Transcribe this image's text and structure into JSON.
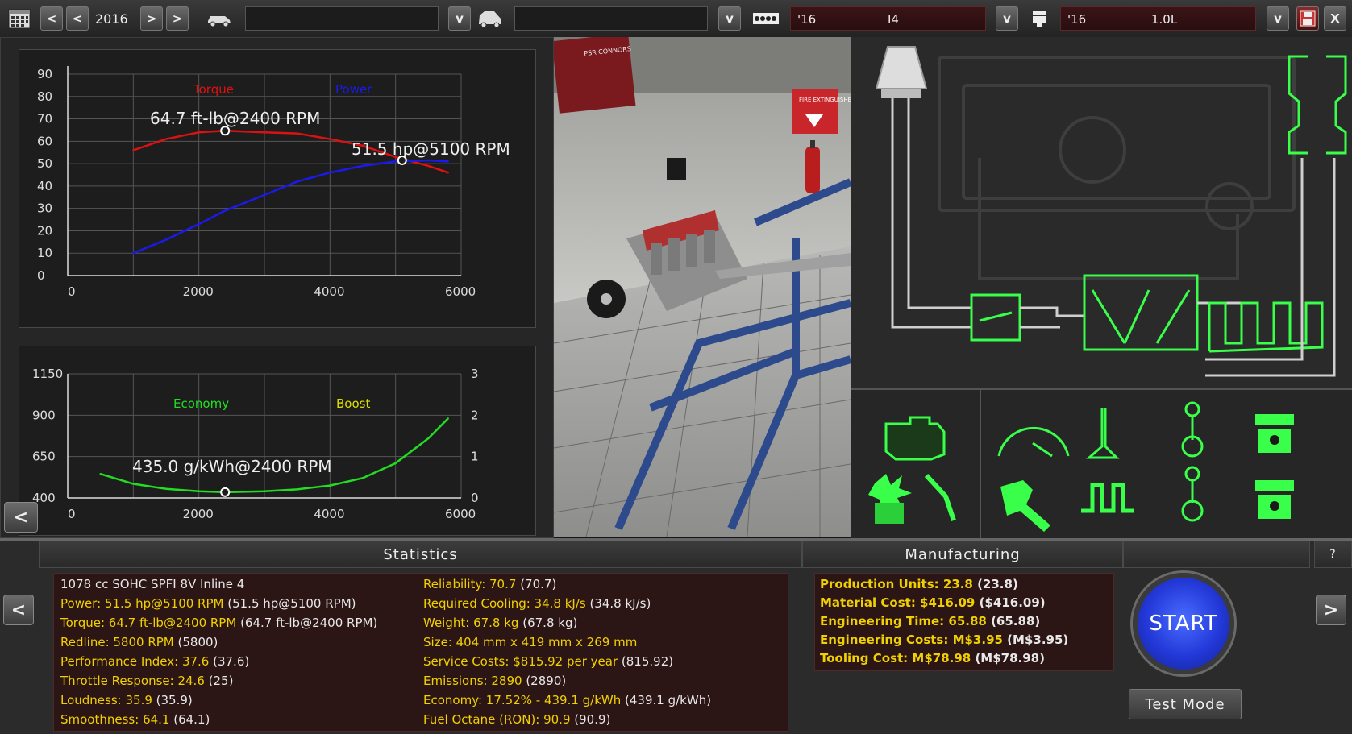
{
  "toolbar": {
    "year": "2016",
    "engine_family_year": "'16",
    "engine_family_layout": "I4",
    "variant_year": "'16",
    "variant_displacement": "1.0L",
    "prev_label": "<",
    "next_label": ">",
    "dropdown_label": "v",
    "close_label": "X"
  },
  "power_chart": {
    "legend_torque": "Torque",
    "legend_power": "Power",
    "annotation_torque": "64.7 ft-lb@2400 RPM",
    "annotation_power": "51.5 hp@5100 RPM",
    "yticks": [
      "90",
      "80",
      "70",
      "60",
      "50",
      "40",
      "30",
      "20",
      "10",
      "0"
    ],
    "xticks": [
      "0",
      "2000",
      "4000",
      "6000"
    ],
    "colors": {
      "torque": "#dd1111",
      "power": "#1a1aee"
    }
  },
  "econ_chart": {
    "legend_economy": "Economy",
    "legend_boost": "Boost",
    "annotation_economy": "435.0 g/kWh@2400 RPM",
    "yticks_left": [
      "1150",
      "900",
      "650",
      "400"
    ],
    "yticks_right": [
      "3",
      "2",
      "1",
      "0"
    ],
    "xticks": [
      "0",
      "2000",
      "4000",
      "6000"
    ],
    "colors": {
      "economy": "#22dd22",
      "boost": "#dddd00"
    }
  },
  "chart_data": [
    {
      "type": "line",
      "x": [
        1000,
        1500,
        2000,
        2400,
        3000,
        3500,
        4000,
        4500,
        5000,
        5500,
        5800
      ],
      "series": [
        {
          "name": "Torque",
          "values": [
            56,
            61,
            64,
            64.7,
            64,
            63.5,
            61,
            58,
            53,
            49,
            46
          ]
        },
        {
          "name": "Power",
          "values": [
            10,
            16,
            23,
            29,
            36,
            42,
            46,
            49,
            51,
            51.5,
            51
          ]
        }
      ],
      "xlim": [
        0,
        6000
      ],
      "ylim": [
        0,
        90
      ],
      "legend": "top"
    },
    {
      "type": "line",
      "x": [
        500,
        1000,
        1500,
        2000,
        2400,
        3000,
        3500,
        4000,
        4500,
        5000,
        5500,
        5800
      ],
      "series": [
        {
          "name": "Economy",
          "values": [
            545,
            485,
            455,
            440,
            435,
            440,
            452,
            475,
            520,
            610,
            760,
            880
          ]
        },
        {
          "name": "Boost",
          "values": []
        }
      ],
      "xlim": [
        0,
        6000
      ],
      "ylim": [
        400,
        1150
      ],
      "y2lim": [
        0,
        3
      ],
      "legend": "top"
    }
  ],
  "sections": {
    "statistics": "Statistics",
    "manufacturing": "Manufacturing",
    "help": "?"
  },
  "stats_left": [
    {
      "label": "1078 cc SOHC SPFI 8V Inline 4",
      "value": ""
    },
    {
      "label": "Power: 51.5 hp@5100 RPM",
      "value": " (51.5 hp@5100 RPM)"
    },
    {
      "label": "Torque: 64.7 ft-lb@2400 RPM",
      "value": " (64.7 ft-lb@2400 RPM)"
    },
    {
      "label": "Redline: 5800 RPM",
      "value": " (5800)"
    },
    {
      "label": "Performance Index: 37.6",
      "value": " (37.6)"
    },
    {
      "label": "Throttle Response: 24.6",
      "value": " (25)"
    },
    {
      "label": "Loudness: 35.9",
      "value": " (35.9)"
    },
    {
      "label": "Smoothness: 64.1",
      "value": " (64.1)"
    }
  ],
  "stats_right": [
    {
      "label": "Reliability: 70.7",
      "value": " (70.7)"
    },
    {
      "label": "Required Cooling: 34.8 kJ/s",
      "value": " (34.8 kJ/s)"
    },
    {
      "label": "Weight: 67.8 kg",
      "value": " (67.8 kg)"
    },
    {
      "label": "Size: 404 mm x 419 mm x 269 mm",
      "value": ""
    },
    {
      "label": "Service Costs: $815.92 per year",
      "value": " (815.92)"
    },
    {
      "label": "Emissions: 2890",
      "value": " (2890)"
    },
    {
      "label": "Economy: 17.52% - 439.1 g/kWh",
      "value": " (439.1 g/kWh)"
    },
    {
      "label": "Fuel Octane (RON): 90.9",
      "value": " (90.9)"
    }
  ],
  "manufacturing": [
    {
      "label": "Production Units: 23.8",
      "value": " (23.8)"
    },
    {
      "label": "Material Cost: $416.09",
      "value": " ($416.09)"
    },
    {
      "label": "Engineering Time: 65.88",
      "value": " (65.88)"
    },
    {
      "label": "Engineering Costs: M$3.95",
      "value": " (M$3.95)"
    },
    {
      "label": "Tooling Cost: M$78.98",
      "value": " (M$78.98)"
    }
  ],
  "actions": {
    "start": "START",
    "test_mode": "Test Mode"
  },
  "scene": {
    "poster_text": "PSR CONNORS",
    "sign_text": "FIRE EXTINGUISHER"
  }
}
